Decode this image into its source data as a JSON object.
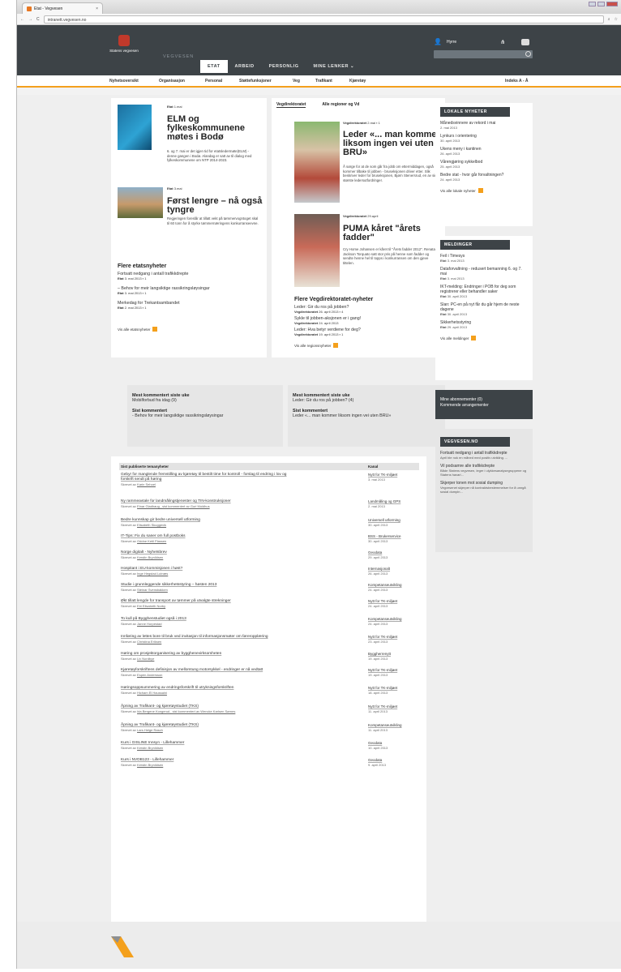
{
  "browser": {
    "tab_title": "Etat - Vegvesen",
    "tab_close": "×",
    "url": "intranett.vegvesen.no"
  },
  "header": {
    "logo_text": "Statens vegvesen",
    "site_name": "VEGVESEN",
    "nav": [
      "ETAT",
      "ARBEID",
      "PERSONLIG",
      "MINE LENKER ⌄"
    ],
    "user": "Hyrre"
  },
  "subnav": {
    "items": [
      "Nyhetsoversikt",
      "Organisasjon",
      "Personal",
      "Støttefunksjoner",
      "Veg",
      "Trafikant",
      "Kjøretøy"
    ],
    "index": "Indeks A - Å"
  },
  "etat": {
    "a1": {
      "tag": "Etat",
      "date": "1.mai",
      "title": "ELM og fylkeskommunene møtes i Bodø",
      "text": "6. og 7. mai er det igjen tid for etatsledermøte(ELM) - denne gangen i Bodø. Alandag er satt av til dialog med fylkeskommunene om NTP 2014-2023."
    },
    "a2": {
      "tag": "Etat",
      "date": "3.mai",
      "title": "Først lengre – nå også tyngre",
      "text": "Regjeringen foreslår at tillatt vekt på tømmervogntoget skal til 60 tonn for å styrke tømmernæringens konkurranseevne."
    },
    "more_title": "Flere etatsnyheter",
    "more": [
      {
        "t": "Fortsatt nedgang i antall trafikkdrepte",
        "m": "Etat",
        "d": "3. mai 2013",
        "c": "1"
      },
      {
        "t": "– Behov for meir langsiktige rassikringsløysingar",
        "m": "Etat",
        "d": "3. mai 2013",
        "c": "1"
      },
      {
        "t": "Merkedag for Trekantsambandet",
        "m": "Etat",
        "d": "2. mai 2013",
        "c": "1"
      }
    ],
    "all": "Vis alle etatsnyheter"
  },
  "vd": {
    "tabs": [
      "Vegdirektoratet",
      "Alle regioner og Vd"
    ],
    "a1": {
      "tag": "Vegdirektoratet",
      "date": "2.mai",
      "c": "1",
      "title": "Leder «... man kommer liksom ingen vei uten BRU»",
      "text": "Å sørge for at de som går fra jobb om ettermiddagen, også kommer tilbake til jobben - bruseksjonen driver etter. Slik beskriver leder for bruseksjonen, Bjørn Stenersrud, en av sine største ledersutfordringer."
    },
    "a2": {
      "tag": "Vegdirektoratet",
      "date": "29.april",
      "title": "PUMA kåret \"årets fadder\"",
      "text": "Cry Home Johansen er kåret til \"Årets fadder 2012\". Renata Jackson Torquato satt stor pris på henne som fadder og sendte henne hel til topps i konkurransen om den gjeve tittelen."
    },
    "more_title": "Flere Vegdirektoratet-nyheter",
    "more": [
      {
        "t": "Leder: Gir du ros på jobben?",
        "m": "Vegdirektoratet",
        "d": "26. april 2013",
        "c": "4"
      },
      {
        "t": "Sykle til jobben-aksjonen er i gang!",
        "m": "Vegdirektoratet",
        "d": "24. april 2013",
        "c": ""
      },
      {
        "t": "Leder: Hva betyr verdiene for deg?",
        "m": "Vegdirektoratet",
        "d": "19. april 2013",
        "c": "1"
      }
    ],
    "all": "Vis alle regionsnyheter"
  },
  "lokale": {
    "title": "LOKALE NYHETER",
    "items": [
      {
        "t": "Månedsvinnere av rekord i mai",
        "d": "2. mai 2013"
      },
      {
        "t": "Lynkurs i orientering",
        "d": "30. april 2013"
      },
      {
        "t": "Ukens meny i kantinen",
        "d": "26. april 2013"
      },
      {
        "t": "Vårengjøring sykkelbod",
        "d": "25. april 2013"
      },
      {
        "t": "Bedre stat - hvor går forvaltningen?",
        "d": "24. april 2013"
      }
    ],
    "all": "Vis alle lokale nyheter"
  },
  "meldinger": {
    "title": "MELDINGER",
    "items": [
      {
        "t": "Feil i Timesys",
        "m": "Etat",
        "d": "3. mai 2013"
      },
      {
        "t": "Dataforvaltning - redusert bemanning 6. og 7. mai",
        "m": "Etat",
        "d": "3. mai 2013"
      },
      {
        "t": "IKT-melding: Endringer i POB for deg som registrerer eller behandler saker",
        "m": "Etat",
        "d": "30. april 2013"
      },
      {
        "t": "Slan: PC-en på nyt får du går hjem de neste dagene",
        "m": "Etat",
        "d": "30. april 2013"
      },
      {
        "t": "Sikkerhetsstyring",
        "m": "Etat",
        "d": "29. april 2013"
      }
    ],
    "all": "Vis alle meldinger"
  },
  "stats_left": {
    "h1": "Mest kommentert siste uke",
    "v1": "Mobilforbud fra idag (9)",
    "h2": "Sist kommentert",
    "v2": "- Behov for meir langsiktige rassikringsløysingar"
  },
  "stats_mid": {
    "h1": "Mest kommentert siste uke",
    "v1": "Leder: Gir du ros på jobben? (4)",
    "h2": "Sist kommentert",
    "v2": "Leder «... man kommer liksom ingen vei uten BRU»"
  },
  "abonnement": {
    "l1": "Mine abonnementer (0)",
    "l2": "Kommende arrangementer"
  },
  "vegvesen_no": {
    "title": "VEGVESEN.NO",
    "items": [
      {
        "t": "Fortsatt nedgang i antall trafikkdrepte",
        "s": "April ble nok en måned med positiv utvikling. ..."
      },
      {
        "t": "Vil podsamre alle trafikkdrepte",
        "s": "Både Statens vegvesen, leger i ulykkesanalysegruppene og Statens havari..."
      },
      {
        "t": "Skjerper tonen mot sosial dumping",
        "s": "Vegvesenet skjerper nå kontraktsbestemmelser for å unngå sosial dumpin..."
      }
    ]
  },
  "table": {
    "h1": "Sist publiserte temanyheter",
    "h2": "Kanal",
    "rows": [
      {
        "t": "Gebyr for manglende fremstilling av kjøretøy til bestilt time for kontroll - forslag til endring i lov og",
        "t2": "forskrift sendt på høring",
        "by": "Skrevet av",
        "p": "Karin Sehoel",
        "k": "Nytt for TK-miljøet",
        "d": "3. mai 2013"
      },
      {
        "t": "Ny rammeavtale for landmålingstjenester og TIN-konstruksjoner",
        "by": "Skrevet av",
        "p": "Einar Gladhaug , sist kommentert av Guri Moldhus",
        "k": "Landmåling og GPS",
        "d": "2. mai 2013"
      },
      {
        "t": "Bedre kunnskap gir bedre universell utforming",
        "by": "Skrevet av",
        "p": "Elisabeth Skuggevik",
        "k": "Universell utforming",
        "d": "30. april 2013"
      },
      {
        "t": "IT-Tips: Fix du saner om full postboks",
        "by": "Skrevet av",
        "p": "Oddne Ketil Plassen",
        "k": "BSS - Brukerservice",
        "d": "30. april 2013"
      },
      {
        "t": "Norge digitalt - Nyhetsbrev",
        "by": "Skrevet av",
        "p": "Kerstin Brynildsen",
        "k": "Geodata",
        "d": "29. april 2013"
      },
      {
        "t": "Hospitant i EU-kommisjonen i høst?",
        "by": "Skrevet av",
        "p": "Inge Hegstad Lutnæs",
        "k": "Internasjonalt",
        "d": "26. april 2013"
      },
      {
        "t": "Studie i grunnleggende sikkerhetsstyring – høsten 2013",
        "by": "Skrevet av",
        "p": "Steinar Svensbakken",
        "k": "Kompetanseutvikling",
        "d": "24. april 2013"
      },
      {
        "t": "Økt tillatt lengde for transport av tømmer på utvalgte strekninger",
        "by": "Skrevet av",
        "p": "Eiri Elisabeth Norby",
        "k": "Nytt for TK-miljøet",
        "d": "24. april 2013"
      },
      {
        "t": "To kull på Bygghenstudiet også i 2013",
        "by": "Skrevet av",
        "p": "Janne Horpestad",
        "k": "Kompetanseutvikling",
        "d": "24. april 2013"
      },
      {
        "t": "Innføring av lettes bore til bruk ved invitasjon til informasjonsmøter om føreropplæring",
        "by": "Skrevet av",
        "p": "Christina Eriksen",
        "k": "Nytt for TK-miljøet",
        "d": "23. april 2013"
      },
      {
        "t": "Høring om prosjektorganisering av bygghenevirksomheten",
        "by": "Skrevet av",
        "p": "Liv Nordbye",
        "k": "Byggherrenytt",
        "d": "19. april 2013"
      },
      {
        "t": "Kjøretøyforskriftens definisjon av mellomtung motorsykkel - endringer er nå vedtatt",
        "by": "Skrevet av",
        "p": "Espen Andersson",
        "k": "Nytt for TK-miljøet",
        "d": "19. april 2013"
      },
      {
        "t": "Høringsoppsummering av endringsforskrift til utrykningsforskriften",
        "by": "Skrevet av",
        "p": "Hicham El Haussaini",
        "k": "Nytt for TK-miljøet",
        "d": "18. april 2013"
      },
      {
        "t": "Åpning av Trafikant- og kjøretøystudiet (TKS)",
        "by": "Skrevet av",
        "p": "Ida Bergene Kongerud , sist kommentert av Wencke Karlsen Sørnes",
        "k": "Nytt for TK-miljøet",
        "d": "11. april 2013"
      },
      {
        "t": "Åpning av Trafikant- og kjøretøystudiet (TKS)",
        "by": "Skrevet av",
        "p": "Lars Helge Rasch",
        "k": "Kompetanseutvikling",
        "d": "11. april 2013"
      },
      {
        "t": "Kurs i GISLINE Innsyn - Lillehammer",
        "by": "Skrevet av",
        "p": "Kerstin Brynildsen",
        "k": "Geodata",
        "d": "10. april 2013"
      },
      {
        "t": "Kurs i NVDB123 - Lillehammer",
        "by": "Skrevet av",
        "p": "Kerstin Brynildsen",
        "k": "Geodata",
        "d": "9. april 2013"
      }
    ]
  }
}
